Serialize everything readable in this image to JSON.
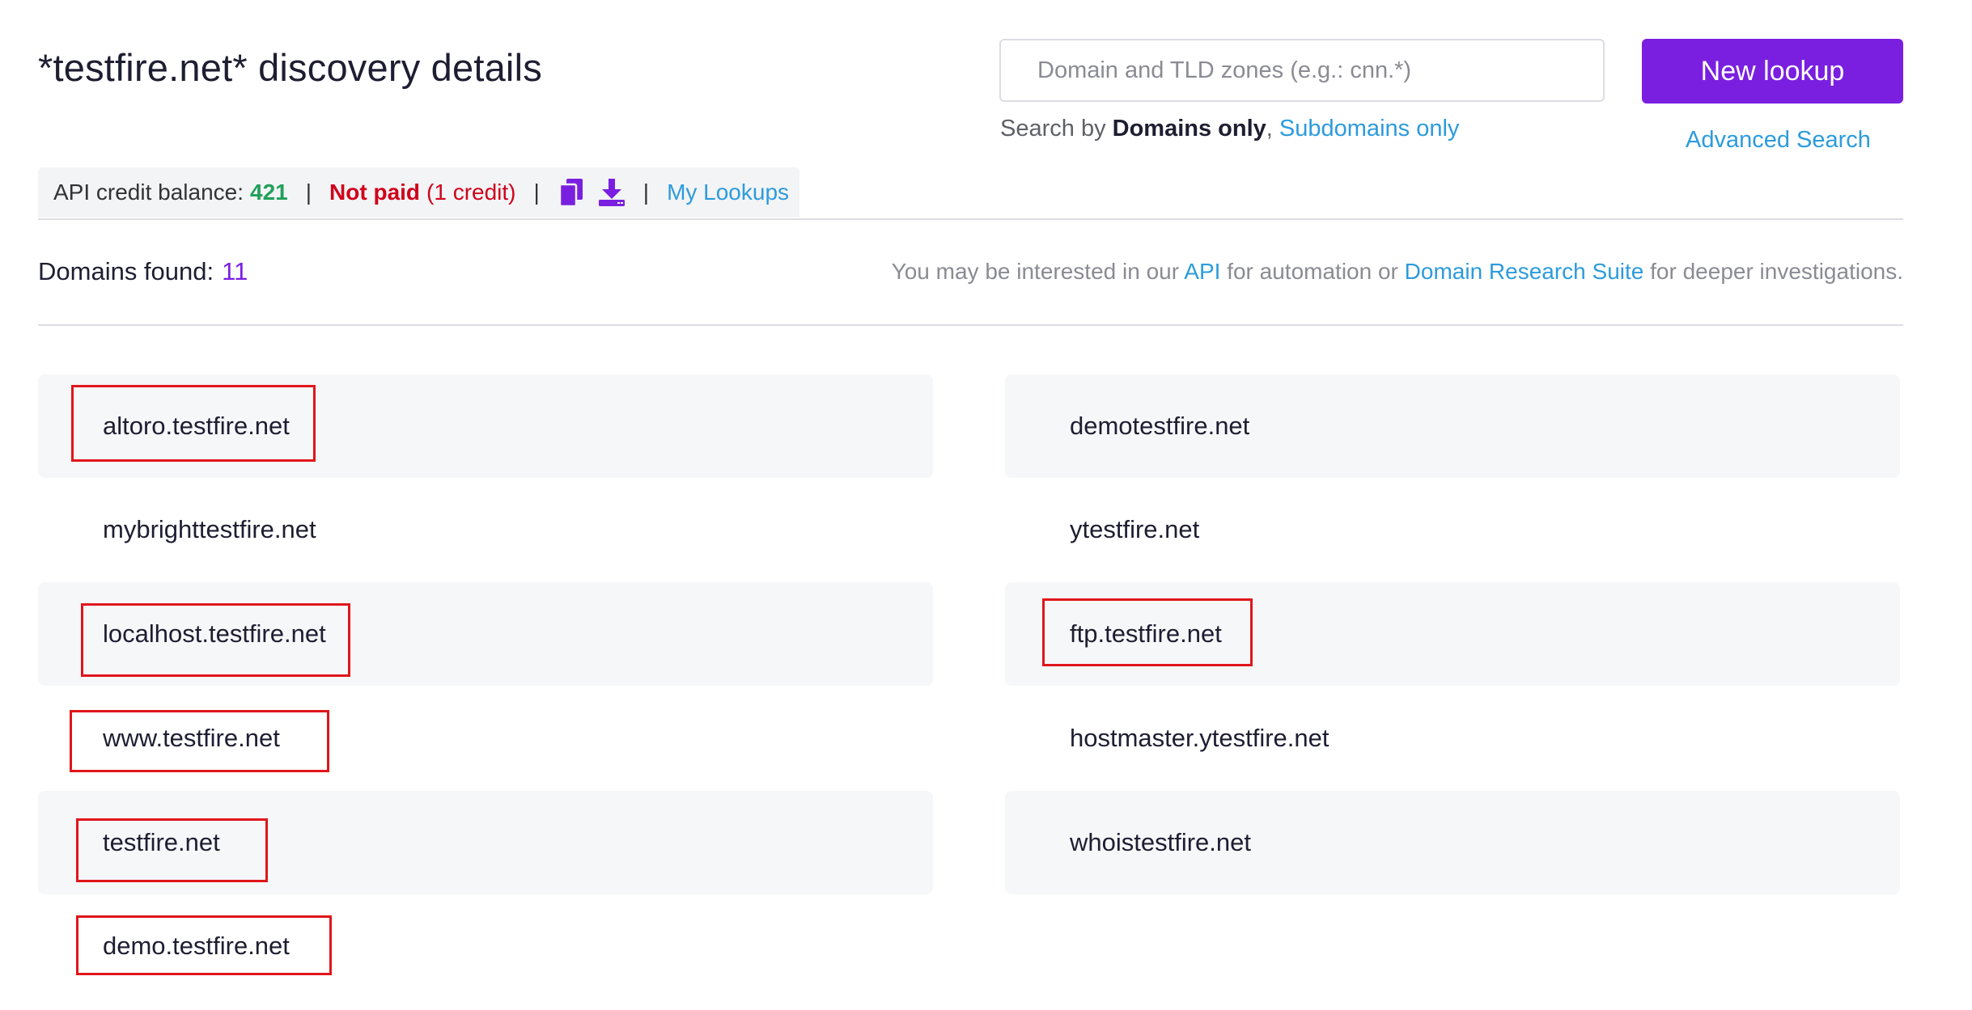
{
  "header": {
    "title": "*testfire.net* discovery details"
  },
  "search": {
    "placeholder": "Domain and TLD zones (e.g.: cnn.*)",
    "search_by_prefix": "Search by",
    "domains_only": "Domains only",
    "comma": ",",
    "subdomains_only": "Subdomains only",
    "new_lookup": "New lookup",
    "advanced_search": "Advanced Search"
  },
  "credits": {
    "label": "API credit balance:",
    "balance": "421",
    "sep": "|",
    "not_paid": "Not paid",
    "cost": "(1 credit)",
    "my_lookups": "My Lookups",
    "accent": "#7a1fe0"
  },
  "results": {
    "label": "Domains found:",
    "count": "11",
    "interest_prefix": "You may be interested in our",
    "api_link": "API",
    "interest_mid": "for automation or",
    "drs_link": "Domain Research Suite",
    "interest_suffix": "for deeper investigations.",
    "left_column": [
      "altoro.testfire.net",
      "mybrighttestfire.net",
      "localhost.testfire.net",
      "www.testfire.net",
      "testfire.net",
      "demo.testfire.net"
    ],
    "right_column": [
      "demotestfire.net",
      "ytestfire.net",
      "ftp.testfire.net",
      "hostmaster.ytestfire.net",
      "whoistestfire.net"
    ]
  }
}
